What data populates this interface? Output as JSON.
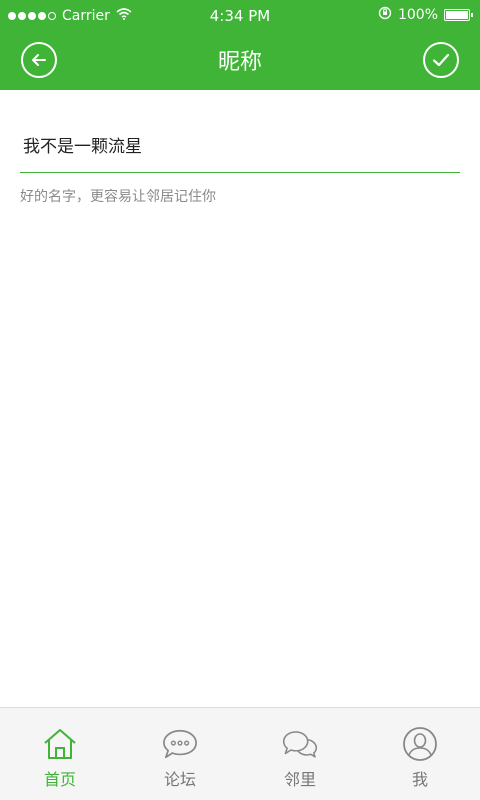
{
  "status_bar": {
    "carrier": "Carrier",
    "time": "4:34 PM",
    "battery_text": "100%",
    "battery_level": 1.0
  },
  "header": {
    "title": "昵称",
    "back_icon": "arrow-left-circle-icon",
    "confirm_icon": "check-circle-icon"
  },
  "nickname_field": {
    "value": "我不是一颗流星"
  },
  "hint": "好的名字，更容易让邻居记住你",
  "tabbar": {
    "items": [
      {
        "label": "首页",
        "icon": "home-icon",
        "active": true
      },
      {
        "label": "论坛",
        "icon": "forum-bubble-icon",
        "active": false
      },
      {
        "label": "邻里",
        "icon": "neighbors-bubbles-icon",
        "active": false
      },
      {
        "label": "我",
        "icon": "profile-icon",
        "active": false
      }
    ]
  },
  "colors": {
    "accent": "#3fb437",
    "tab_inactive": "#777777",
    "hint_text": "#8a8a8a"
  }
}
